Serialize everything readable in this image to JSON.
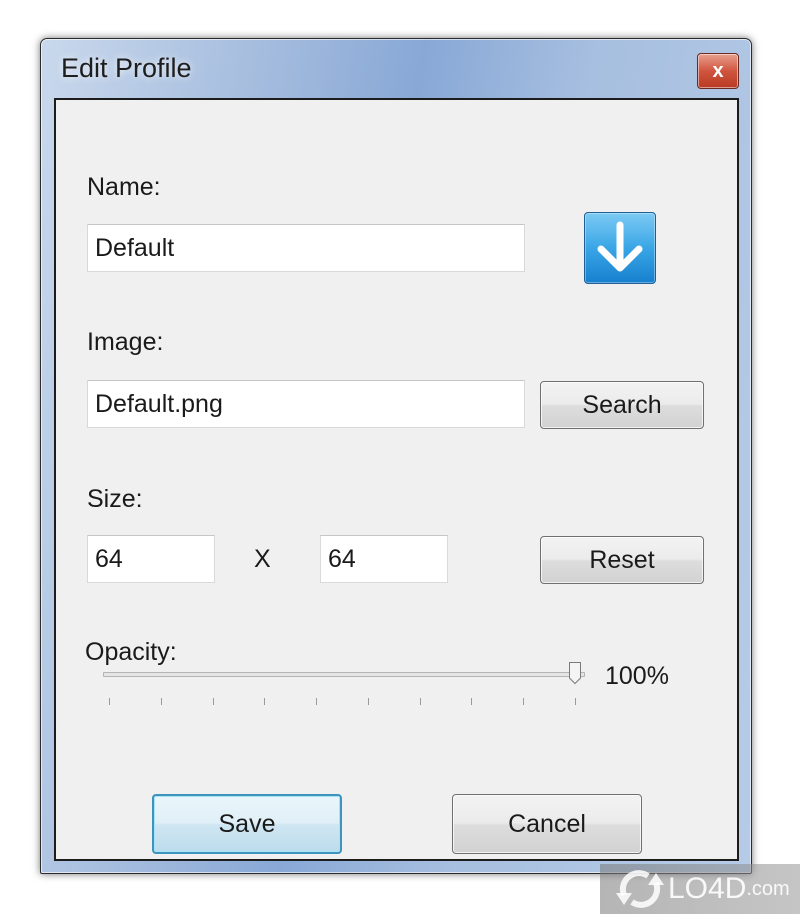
{
  "window": {
    "title": "Edit Profile",
    "close_glyph": "x"
  },
  "form": {
    "name": {
      "label": "Name:",
      "value": "Default"
    },
    "image": {
      "label": "Image:",
      "value": "Default.png",
      "button": "Search"
    },
    "size": {
      "label": "Size:",
      "width": "64",
      "separator": "X",
      "height": "64",
      "button": "Reset"
    },
    "opacity": {
      "label": "Opacity:",
      "value_text": "100%",
      "value_percent": 100,
      "tick_count": 10
    },
    "icon": "download-arrow-icon"
  },
  "buttons": {
    "save": "Save",
    "cancel": "Cancel"
  },
  "colors": {
    "titlebar": "#9fb8dc",
    "close_button": "#c8472f",
    "client_bg": "#f0f0f0",
    "default_button_border": "#3d95bd",
    "icon_blue": "#2a93dc"
  },
  "watermark": {
    "brand": "LO4D",
    "suffix": ".com"
  }
}
